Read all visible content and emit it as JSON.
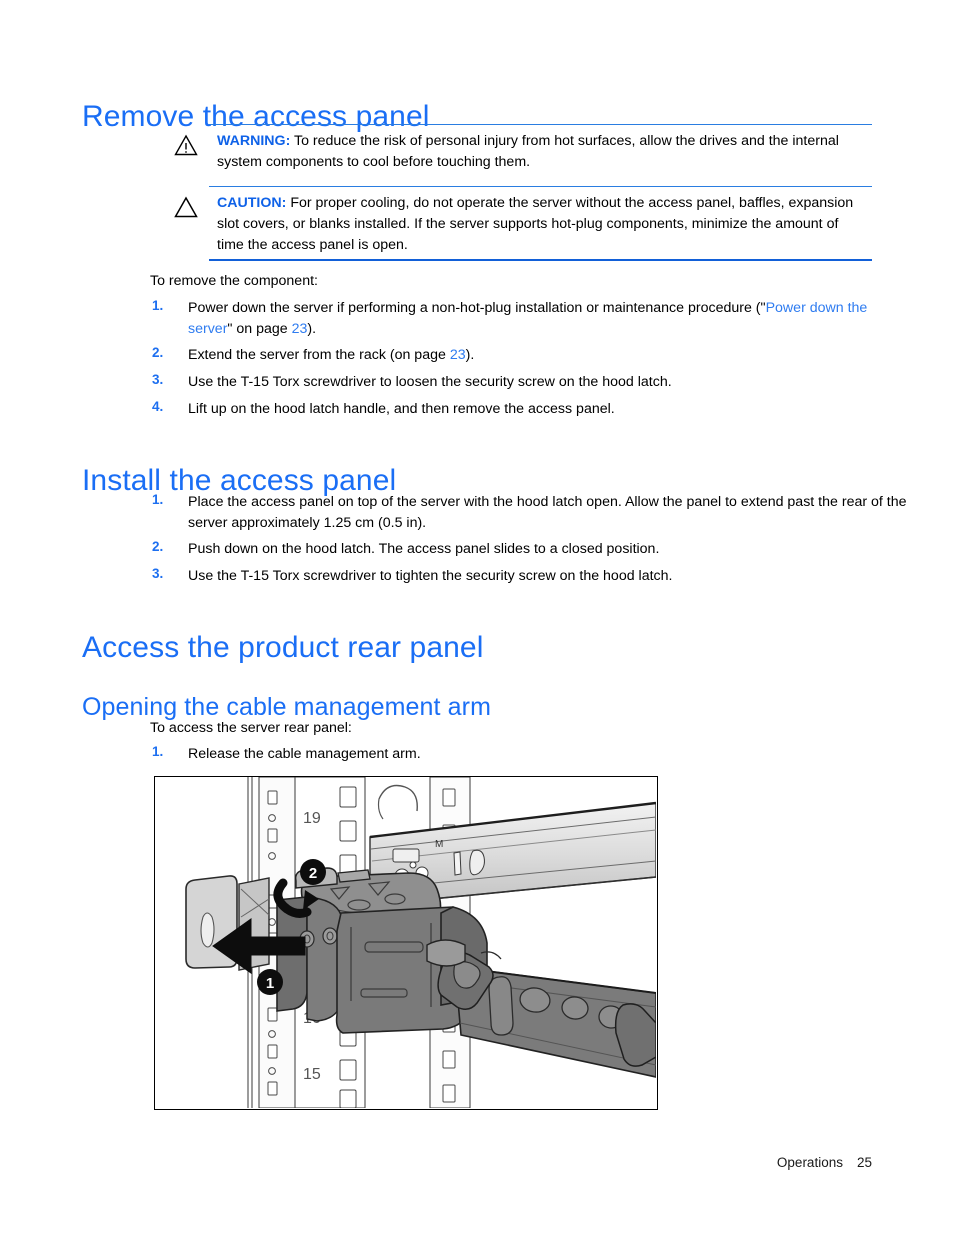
{
  "document": {
    "footer": {
      "section": "Operations",
      "page_number": "25"
    }
  },
  "sections": [
    {
      "heading": "Remove the access panel",
      "admonitions": [
        {
          "icon": "warning-triangle-icon",
          "label": "WARNING:",
          "text": "To reduce the risk of personal injury from hot surfaces, allow the drives and the internal system components to cool before touching them."
        },
        {
          "icon": "caution-triangle-icon",
          "label": "CAUTION:",
          "text": "For proper cooling, do not operate the server without the access panel, baffles, expansion slot covers, or blanks installed. If the server supports hot-plug components, minimize the amount of time the access panel is open."
        }
      ],
      "intro": "To remove the component:",
      "steps": [
        {
          "number": "1.",
          "parts": [
            {
              "type": "text",
              "value": "Power down the server if performing a non-hot-plug installation or maintenance procedure (\""
            },
            {
              "type": "link",
              "value": "Power down the server"
            },
            {
              "type": "text",
              "value": "\" on page "
            },
            {
              "type": "link",
              "value": "23"
            },
            {
              "type": "text",
              "value": ")."
            }
          ]
        },
        {
          "number": "2.",
          "parts": [
            {
              "type": "text",
              "value": "Extend the server from the rack (on page "
            },
            {
              "type": "link",
              "value": "23"
            },
            {
              "type": "text",
              "value": ")."
            }
          ]
        },
        {
          "number": "3.",
          "parts": [
            {
              "type": "text",
              "value": "Use the T-15 Torx screwdriver to loosen the security screw on the hood latch."
            }
          ]
        },
        {
          "number": "4.",
          "parts": [
            {
              "type": "text",
              "value": "Lift up on the hood latch handle, and then remove the access panel."
            }
          ]
        }
      ]
    },
    {
      "heading": "Install the access panel",
      "steps": [
        {
          "number": "1.",
          "parts": [
            {
              "type": "text",
              "value": "Place the access panel on top of the server with the hood latch open. Allow the panel to extend past the rear of the server approximately 1.25 cm (0.5 in)."
            }
          ]
        },
        {
          "number": "2.",
          "parts": [
            {
              "type": "text",
              "value": "Push down on the hood latch. The access panel slides to a closed position."
            }
          ]
        },
        {
          "number": "3.",
          "parts": [
            {
              "type": "text",
              "value": "Use the T-15 Torx screwdriver to tighten the security screw on the hood latch."
            }
          ]
        }
      ]
    },
    {
      "heading": "Access the product rear panel",
      "subheading": "Opening the cable management arm",
      "intro": "To access the server rear panel:",
      "steps": [
        {
          "number": "1.",
          "parts": [
            {
              "type": "text",
              "value": "Release the cable management arm."
            }
          ]
        }
      ]
    }
  ],
  "figure": {
    "alt": "Cable management arm release illustration",
    "callouts": [
      "1",
      "2"
    ],
    "rack_unit_labels": [
      "19",
      "16",
      "15"
    ]
  },
  "colors": {
    "heading_blue": "#1a6ef5",
    "link_blue": "#2f7cf0",
    "rule_blue": "#1260d8",
    "label_blue": "#0f62e8",
    "text_black": "#000000"
  }
}
